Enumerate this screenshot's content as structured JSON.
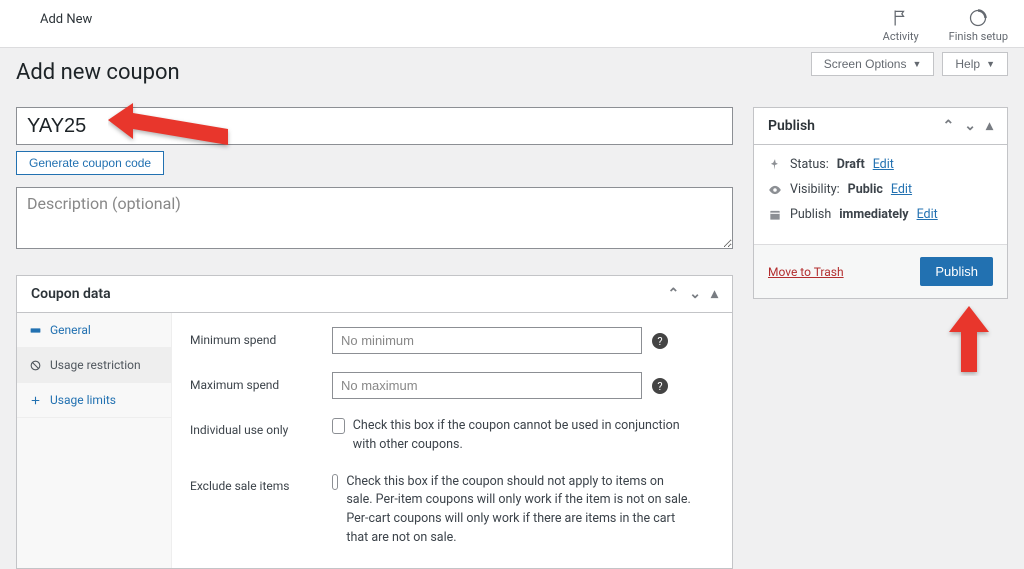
{
  "topbar": {
    "add_new": "Add New",
    "activity": "Activity",
    "finish_setup": "Finish setup"
  },
  "screen_options_label": "Screen Options",
  "help_label": "Help",
  "page_title": "Add new coupon",
  "coupon_code_value": "YAY25",
  "generate_label": "Generate coupon code",
  "description_placeholder": "Description (optional)",
  "coupon_data_title": "Coupon data",
  "tabs": {
    "general": "General",
    "usage_restriction": "Usage restriction",
    "usage_limits": "Usage limits"
  },
  "fields": {
    "min_spend_label": "Minimum spend",
    "min_spend_placeholder": "No minimum",
    "max_spend_label": "Maximum spend",
    "max_spend_placeholder": "No maximum",
    "individual_label": "Individual use only",
    "individual_help": "Check this box if the coupon cannot be used in conjunction with other coupons.",
    "exclude_sale_label": "Exclude sale items",
    "exclude_sale_help": "Check this box if the coupon should not apply to items on sale. Per-item coupons will only work if the item is not on sale. Per-cart coupons will only work if there are items in the cart that are not on sale."
  },
  "publish": {
    "title": "Publish",
    "status_label": "Status:",
    "status_value": "Draft",
    "visibility_label": "Visibility:",
    "visibility_value": "Public",
    "publish_when_label": "Publish",
    "publish_when_value": "immediately",
    "edit_label": "Edit",
    "move_to_trash": "Move to Trash",
    "publish_btn": "Publish"
  }
}
